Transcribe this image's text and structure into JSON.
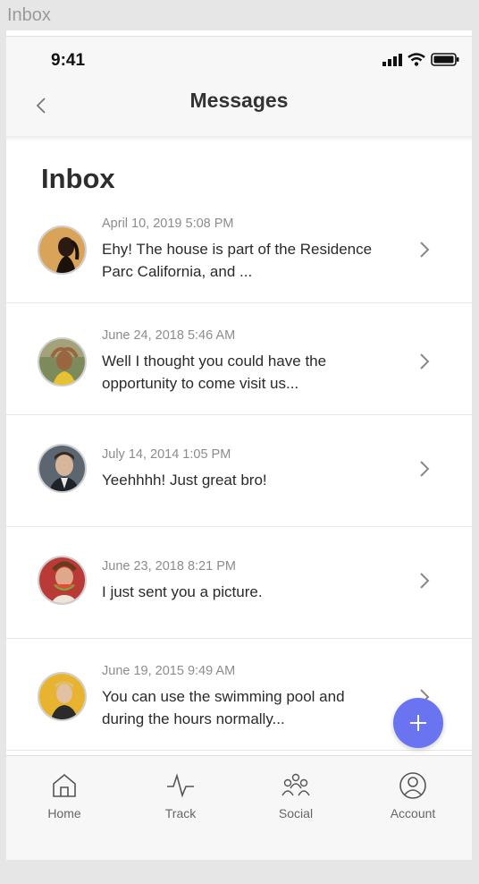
{
  "frame": {
    "label": "Inbox"
  },
  "status_bar": {
    "time": "9:41",
    "icons": [
      "signal-icon",
      "wifi-icon",
      "battery-icon"
    ]
  },
  "header": {
    "title": "Messages",
    "back_icon": "chevron-left-icon"
  },
  "inbox": {
    "title": "Inbox",
    "messages": [
      {
        "date": "April 10, 2019 5:08 PM",
        "text": "Ehy! The house is part of the Residence Parc California, and ..."
      },
      {
        "date": "June 24, 2018 5:46 AM",
        "text": "Well I thought you could have the opportunity to come visit us..."
      },
      {
        "date": "July 14, 2014 1:05 PM",
        "text": "Yeehhhh! Just great bro!"
      },
      {
        "date": "June 23, 2018 8:21 PM",
        "text": "I just sent you a picture."
      },
      {
        "date": "June 19, 2015 9:49 AM",
        "text": "You can use the swimming pool and during the hours normally..."
      }
    ]
  },
  "fab": {
    "icon": "plus-icon",
    "color": "#6b74f0"
  },
  "tabbar": {
    "tabs": [
      {
        "label": "Home",
        "icon": "home-icon"
      },
      {
        "label": "Track",
        "icon": "pulse-icon"
      },
      {
        "label": "Social",
        "icon": "people-icon"
      },
      {
        "label": "Account",
        "icon": "account-icon"
      }
    ]
  }
}
